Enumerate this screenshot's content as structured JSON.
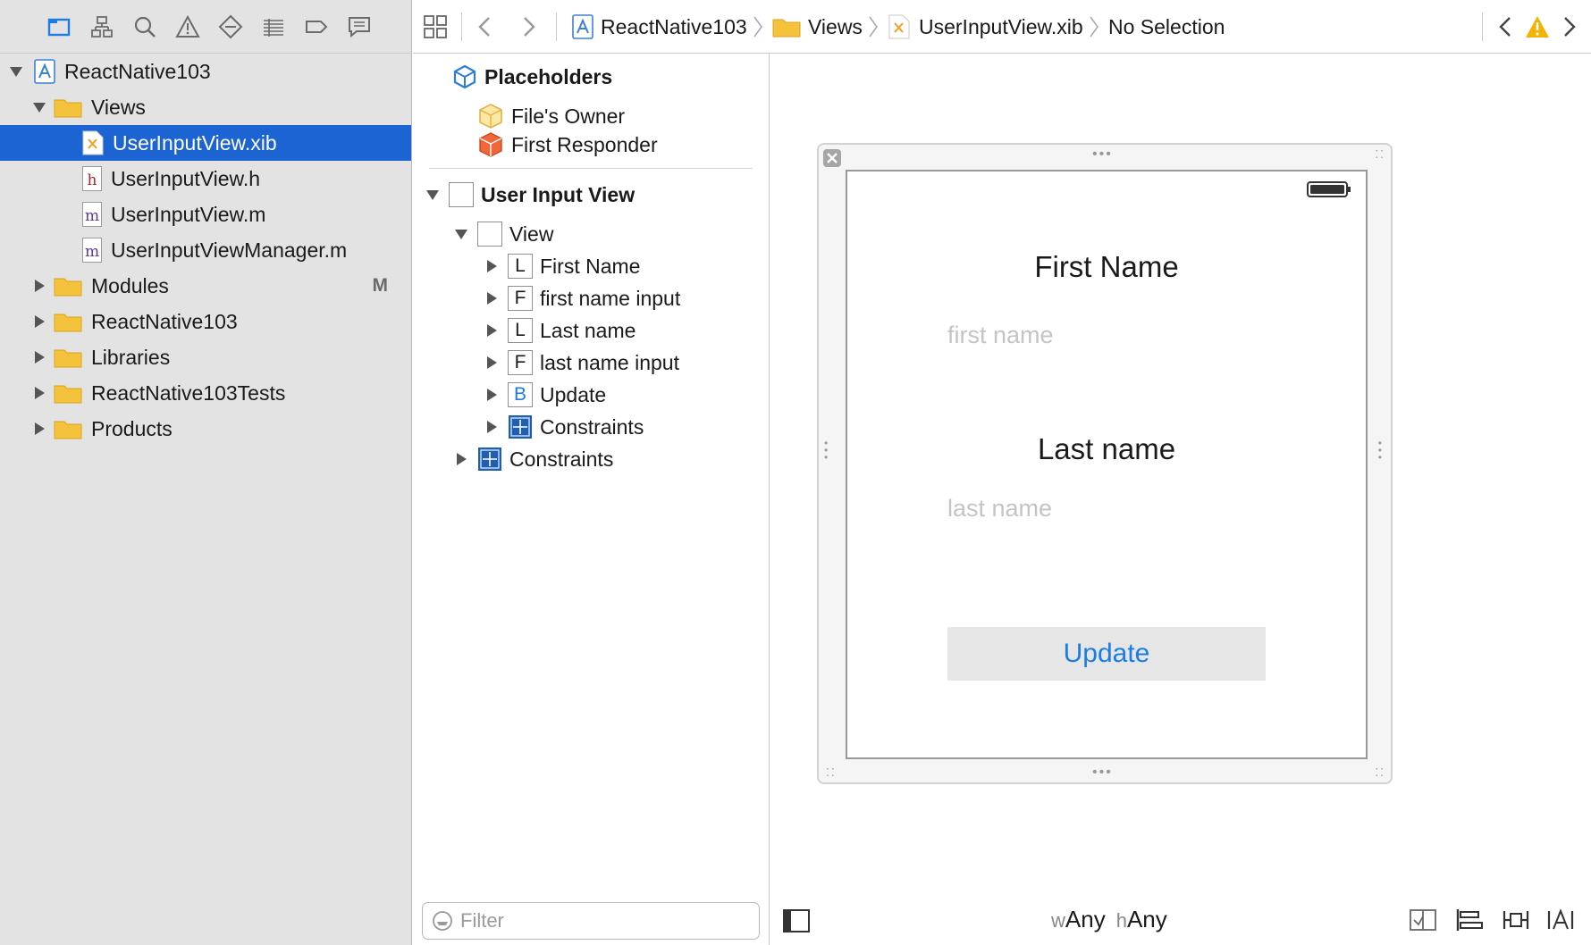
{
  "navigator": {
    "toolbar_icons": [
      "project-navigator-icon",
      "symbol-navigator-icon",
      "find-navigator-icon",
      "issue-navigator-icon",
      "test-navigator-icon",
      "debug-navigator-icon",
      "breakpoint-navigator-icon",
      "report-navigator-icon"
    ],
    "items": [
      {
        "label": "ReactNative103",
        "kind": "project",
        "expanded": true
      },
      {
        "label": "Views",
        "kind": "folder",
        "expanded": true
      },
      {
        "label": "UserInputView.xib",
        "kind": "xib",
        "selected": true
      },
      {
        "label": "UserInputView.h",
        "kind": "h"
      },
      {
        "label": "UserInputView.m",
        "kind": "m"
      },
      {
        "label": "UserInputViewManager.m",
        "kind": "m"
      },
      {
        "label": "Modules",
        "kind": "folder",
        "badge": "M"
      },
      {
        "label": "ReactNative103",
        "kind": "folder"
      },
      {
        "label": "Libraries",
        "kind": "folder"
      },
      {
        "label": "ReactNative103Tests",
        "kind": "folder"
      },
      {
        "label": "Products",
        "kind": "folder"
      }
    ]
  },
  "jumpbar": {
    "crumbs": [
      "ReactNative103",
      "Views",
      "UserInputView.xib",
      "No Selection"
    ]
  },
  "outline": {
    "placeholders_title": "Placeholders",
    "files_owner": "File's Owner",
    "first_responder": "First Responder",
    "root_title": "User Input View",
    "view_label": "View",
    "children": [
      {
        "glyph": "L",
        "label": "First Name"
      },
      {
        "glyph": "F",
        "label": "first name input"
      },
      {
        "glyph": "L",
        "label": "Last name"
      },
      {
        "glyph": "F",
        "label": "last name input"
      },
      {
        "glyph": "B",
        "label": "Update"
      },
      {
        "glyph": "+",
        "label": "Constraints"
      }
    ],
    "outer_constraints": "Constraints",
    "filter_placeholder": "Filter"
  },
  "canvas": {
    "first_name_label": "First Name",
    "first_name_placeholder": "first name",
    "last_name_label": "Last name",
    "last_name_placeholder": "last name",
    "update_button": "Update",
    "size_class_w_prefix": "w",
    "size_class_w_value": "Any",
    "size_class_h_prefix": "h",
    "size_class_h_value": "Any"
  },
  "colors": {
    "selection": "#1c64d2",
    "folder": "#f5c33b",
    "link_blue": "#1a7ce6",
    "warning": "#f2b400"
  }
}
